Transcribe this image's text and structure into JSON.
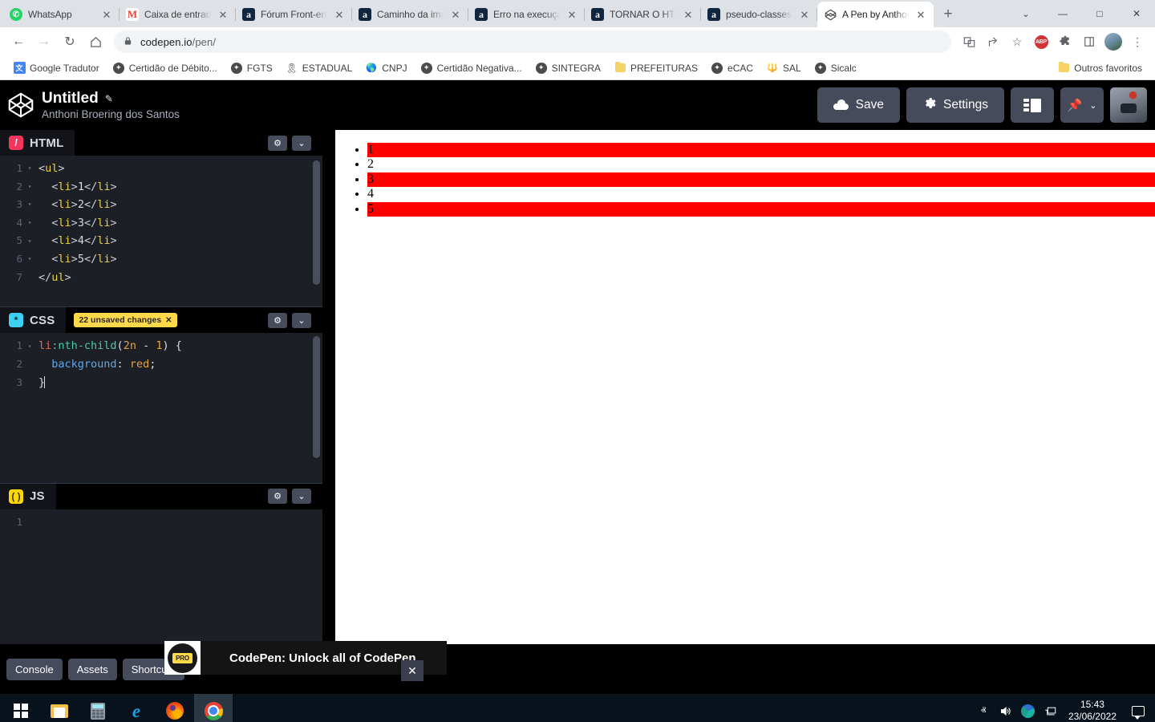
{
  "browser": {
    "tabs": [
      {
        "title": "WhatsApp",
        "favicon": "whatsapp-icon",
        "active": false
      },
      {
        "title": "Caixa de entrada",
        "favicon": "gmail-icon",
        "active": false
      },
      {
        "title": "Fórum Front-end",
        "favicon": "alura-icon",
        "active": false
      },
      {
        "title": "Caminho da imagem",
        "favicon": "alura-icon",
        "active": false
      },
      {
        "title": "Erro na execução",
        "favicon": "alura-icon",
        "active": false
      },
      {
        "title": "TORNAR O HTML",
        "favicon": "alura-icon",
        "active": false
      },
      {
        "title": "pseudo-classes",
        "favicon": "alura-icon",
        "active": false
      },
      {
        "title": "A Pen by Anthoni",
        "favicon": "codepen-icon",
        "active": true
      }
    ],
    "new_tab_label": "+",
    "window_controls": {
      "minimize": "—",
      "maximize": "□",
      "close": "✕",
      "list": "⌄"
    },
    "nav": {
      "back": "←",
      "forward": "→",
      "reload": "↻",
      "home": "⌂"
    },
    "omnibox": {
      "lock": "🔒",
      "url_domain": "codepen.io",
      "url_path": "/pen/"
    },
    "omnibox_right": {
      "translate": "translate-icon",
      "share": "share-icon",
      "bookmark_star": "☆",
      "adblock_label": "ABP",
      "extensions": "puzzle-icon",
      "sidepanel": "panel-icon",
      "menu": "⋮"
    },
    "bookmarks": [
      {
        "label": "Google Tradutor",
        "icon": "translate-icon"
      },
      {
        "label": "Certidão de Débito...",
        "icon": "globe-icon"
      },
      {
        "label": "FGTS",
        "icon": "globe-icon"
      },
      {
        "label": "ESTADUAL",
        "icon": "ribbon-icon"
      },
      {
        "label": "CNPJ",
        "icon": "globe-blue-icon"
      },
      {
        "label": "Certidão Negativa...",
        "icon": "globe-icon"
      },
      {
        "label": "SINTEGRA",
        "icon": "globe-icon"
      },
      {
        "label": "PREFEITURAS",
        "icon": "folder-icon"
      },
      {
        "label": "eCAC",
        "icon": "globe-icon"
      },
      {
        "label": "SAL",
        "icon": "sal-icon"
      },
      {
        "label": "Sicalc",
        "icon": "globe-icon"
      }
    ],
    "other_bookmarks": {
      "label": "Outros favoritos",
      "icon": "folder-icon"
    }
  },
  "codepen": {
    "header": {
      "logo": "codepen-logo",
      "pen_title": "Untitled",
      "edit_icon": "✎",
      "author": "Anthoni Broering dos Santos",
      "save_label": "Save",
      "settings_label": "Settings",
      "layout_button": "layout-icon",
      "pin_button": "pin-icon",
      "pin_chevron": "⌄",
      "avatar": "user-avatar"
    },
    "editors": [
      {
        "id": "html",
        "label": "HTML",
        "badge": "/",
        "unsaved": null,
        "settings_icon": "⚙",
        "collapse_icon": "⌄",
        "lines": [
          {
            "n": "1",
            "fold": "▾",
            "tokens": [
              {
                "t": "brk",
                "v": "<"
              },
              {
                "t": "tag",
                "v": "ul"
              },
              {
                "t": "brk",
                "v": ">"
              }
            ]
          },
          {
            "n": "2",
            "fold": "▾",
            "tokens": [
              {
                "t": "txt",
                "v": "  "
              },
              {
                "t": "brk",
                "v": "<"
              },
              {
                "t": "tag",
                "v": "li"
              },
              {
                "t": "brk",
                "v": ">"
              },
              {
                "t": "txt",
                "v": "1"
              },
              {
                "t": "brk",
                "v": "</"
              },
              {
                "t": "tag",
                "v": "li"
              },
              {
                "t": "brk",
                "v": ">"
              }
            ]
          },
          {
            "n": "3",
            "fold": "▾",
            "tokens": [
              {
                "t": "txt",
                "v": "  "
              },
              {
                "t": "brk",
                "v": "<"
              },
              {
                "t": "tag",
                "v": "li"
              },
              {
                "t": "brk",
                "v": ">"
              },
              {
                "t": "txt",
                "v": "2"
              },
              {
                "t": "brk",
                "v": "</"
              },
              {
                "t": "tag",
                "v": "li"
              },
              {
                "t": "brk",
                "v": ">"
              }
            ]
          },
          {
            "n": "4",
            "fold": "▾",
            "tokens": [
              {
                "t": "txt",
                "v": "  "
              },
              {
                "t": "brk",
                "v": "<"
              },
              {
                "t": "tag",
                "v": "li"
              },
              {
                "t": "brk",
                "v": ">"
              },
              {
                "t": "txt",
                "v": "3"
              },
              {
                "t": "brk",
                "v": "</"
              },
              {
                "t": "tag",
                "v": "li"
              },
              {
                "t": "brk",
                "v": ">"
              }
            ]
          },
          {
            "n": "5",
            "fold": "▾",
            "tokens": [
              {
                "t": "txt",
                "v": "  "
              },
              {
                "t": "brk",
                "v": "<"
              },
              {
                "t": "tag",
                "v": "li"
              },
              {
                "t": "brk",
                "v": ">"
              },
              {
                "t": "txt",
                "v": "4"
              },
              {
                "t": "brk",
                "v": "</"
              },
              {
                "t": "tag",
                "v": "li"
              },
              {
                "t": "brk",
                "v": ">"
              }
            ]
          },
          {
            "n": "6",
            "fold": "▾",
            "tokens": [
              {
                "t": "txt",
                "v": "  "
              },
              {
                "t": "brk",
                "v": "<"
              },
              {
                "t": "tag",
                "v": "li"
              },
              {
                "t": "brk",
                "v": ">"
              },
              {
                "t": "txt",
                "v": "5"
              },
              {
                "t": "brk",
                "v": "</"
              },
              {
                "t": "tag",
                "v": "li"
              },
              {
                "t": "brk",
                "v": ">"
              }
            ]
          },
          {
            "n": "7",
            "fold": "",
            "tokens": [
              {
                "t": "brk",
                "v": "</"
              },
              {
                "t": "tag",
                "v": "ul"
              },
              {
                "t": "brk",
                "v": ">"
              }
            ]
          }
        ],
        "source": "<ul>\n  <li>1</li>\n  <li>2</li>\n  <li>3</li>\n  <li>4</li>\n  <li>5</li>\n</ul>"
      },
      {
        "id": "css",
        "label": "CSS",
        "badge": "*",
        "unsaved": {
          "text": "22 unsaved changes",
          "close": "✕"
        },
        "settings_icon": "⚙",
        "collapse_icon": "⌄",
        "lines": [
          {
            "n": "1",
            "fold": "▾",
            "tokens": [
              {
                "t": "sel",
                "v": "li"
              },
              {
                "t": "pseudo",
                "v": ":nth-child"
              },
              {
                "t": "paren",
                "v": "("
              },
              {
                "t": "num",
                "v": "2n"
              },
              {
                "t": "punc",
                "v": " - "
              },
              {
                "t": "num",
                "v": "1"
              },
              {
                "t": "paren",
                "v": ")"
              },
              {
                "t": "punc",
                "v": " {"
              }
            ]
          },
          {
            "n": "2",
            "fold": "",
            "tokens": [
              {
                "t": "txt",
                "v": "  "
              },
              {
                "t": "prop",
                "v": "background"
              },
              {
                "t": "punc",
                "v": ": "
              },
              {
                "t": "val",
                "v": "red"
              },
              {
                "t": "punc",
                "v": ";"
              }
            ]
          },
          {
            "n": "3",
            "fold": "",
            "tokens": [
              {
                "t": "punc",
                "v": "}"
              },
              {
                "t": "caret",
                "v": ""
              }
            ]
          }
        ],
        "source": "li:nth-child(2n - 1) {\n  background: red;\n}"
      },
      {
        "id": "js",
        "label": "JS",
        "badge": "( )",
        "unsaved": null,
        "settings_icon": "⚙",
        "collapse_icon": "⌄",
        "lines": [
          {
            "n": "1",
            "fold": "",
            "tokens": []
          }
        ],
        "source": ""
      }
    ],
    "preview": {
      "items": [
        {
          "text": "1",
          "highlighted": true
        },
        {
          "text": "2",
          "highlighted": false
        },
        {
          "text": "3",
          "highlighted": true
        },
        {
          "text": "4",
          "highlighted": false
        },
        {
          "text": "5",
          "highlighted": true
        }
      ],
      "highlight_color": "#ff0000"
    },
    "bottom": {
      "console_label": "Console",
      "assets_label": "Assets",
      "shortcuts_label": "Shortcuts",
      "ad": {
        "badge": "PRO",
        "text": "CodePen: Unlock all of CodePen",
        "close": "✕"
      }
    }
  },
  "taskbar": {
    "apps": [
      {
        "name": "start-button",
        "icon": "windows-logo",
        "active": false
      },
      {
        "name": "file-explorer",
        "icon": "folder-icon",
        "active": false
      },
      {
        "name": "calculator",
        "icon": "calculator-icon",
        "active": false
      },
      {
        "name": "internet-explorer",
        "icon": "ie-icon",
        "active": false
      },
      {
        "name": "firefox",
        "icon": "firefox-icon",
        "active": false
      },
      {
        "name": "chrome",
        "icon": "chrome-icon",
        "active": true
      }
    ],
    "tray": {
      "chevron": "ⱏ",
      "volume": "🔊",
      "network_app": "globe-icon",
      "display": "monitor-icon",
      "time": "15:43",
      "date": "23/06/2022",
      "notifications": "notification-icon"
    }
  }
}
